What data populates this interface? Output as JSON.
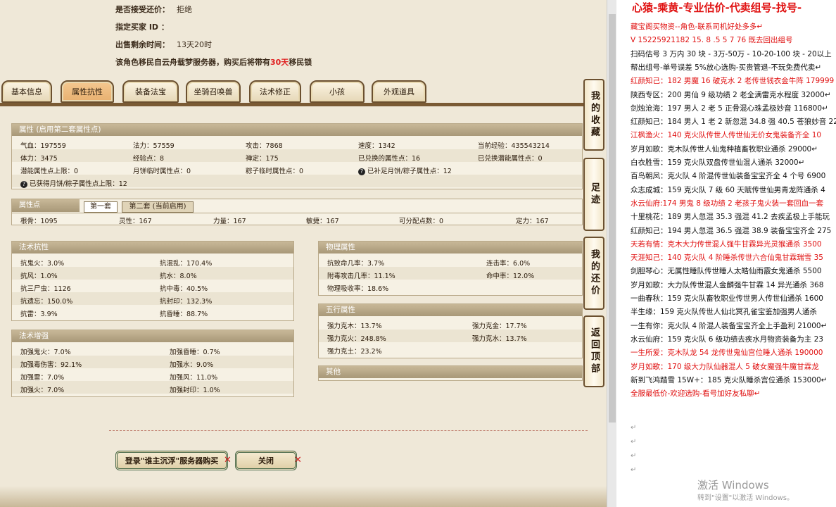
{
  "info": {
    "accept_counter_label": "是否接受还价：",
    "accept_counter_value": "拒绝",
    "buyer_id_label": "指定买家 ID ：",
    "time_left_label": "出售剩余时间：",
    "time_left_value": "13天20时",
    "migrate_prefix": "该角色移民自云舟载梦服务器，购买后将带有",
    "migrate_days": "30天",
    "migrate_suffix": "移民锁"
  },
  "tabs": [
    "基本信息",
    "属性抗性",
    "装备法宝",
    "坐骑召唤兽",
    "法术修正",
    "小孩",
    "外观道具"
  ],
  "attr": {
    "header": "属性 (启用第二套属性点)",
    "row1": [
      "气血：197559",
      "法力：57559",
      "攻击：7868",
      "速度：1342",
      "当前经验：435543214"
    ],
    "row2": [
      "体力：3475",
      "经验点：8",
      "禅定：175",
      "已兑换的属性点：16",
      "已兑换潜能属性点：0"
    ],
    "row3": [
      "潜能属性点上限：0",
      "月饼临时属性点：0",
      "粽子临时属性点：0",
      "已补足月饼/粽子属性点：12"
    ],
    "row4": "已获得月饼/粽子属性点上限：12"
  },
  "points": {
    "header": "属性点",
    "tab1": "第一套",
    "tab2": "第二套 (当前启用)",
    "row": [
      "根骨：1095",
      "灵性：167",
      "力量：167",
      "敏捷：167",
      "可分配点数：0",
      "定力：167"
    ]
  },
  "resist": {
    "header": "法术抗性",
    "left": [
      "抗鬼火：3.0%",
      "抗风：1.0%",
      "抗三尸虫：1126",
      "抗遗忘：150.0%",
      "抗雷：3.9%"
    ],
    "right": [
      "抗混乱：170.4%",
      "抗水：8.0%",
      "抗中毒：40.5%",
      "抗封印：132.3%",
      "抗昏睡：88.7%"
    ]
  },
  "enhance": {
    "header": "法术增强",
    "left": [
      "加强鬼火：7.0%",
      "加强毒伤害：92.1%",
      "加强雷：7.0%",
      "加强火：7.0%"
    ],
    "right": [
      "加强昏睡：0.7%",
      "加强水：9.0%",
      "加强风：11.0%",
      "加强封印：1.0%"
    ]
  },
  "physical": {
    "header": "物理属性",
    "left": [
      "抗致命几率：3.7%",
      "附毒攻击几率：11.1%",
      "物理吸收率：18.6%"
    ],
    "right": [
      "连击率：6.0%",
      "命中率：12.0%"
    ]
  },
  "elements": {
    "header": "五行属性",
    "left": [
      "强力克木：13.7%",
      "强力克火：248.8%",
      "强力克土：23.2%"
    ],
    "right": [
      "强力克金：17.7%",
      "强力克水：13.7%"
    ]
  },
  "other": {
    "header": "其他"
  },
  "side_buttons": [
    "我的收藏",
    "足迹",
    "我的还价",
    "返回顶部"
  ],
  "buttons": {
    "login_buy": "登录\"谁主沉浮\"服务器购买",
    "close": "关闭"
  },
  "doc": {
    "title": "心猿-乘黄-专业估价-代卖组号-找号-",
    "lines": [
      {
        "t": "藏宝阁买物资--角色-联系司机好处多多↵",
        "red": true
      },
      {
        "t": "V 15225921182    15. 8 .5 5 7 76  既去回出组号",
        "red": true
      },
      {
        "t": "扫码估号 3 万内 30 块 - 3万-50万 - 10-20-100 块 - 20以上",
        "red": false
      },
      {
        "t": "帮出组号-单号误差 5%放心选购-买贵管退-不玩免费代卖↵",
        "red": false
      },
      {
        "t": "红颜知己：182 男魔 16 破克水 2 老传世钱衣金牛阵 179999",
        "red": true
      },
      {
        "t": "陕西专区：200 男仙 9 级功绩 2 老全满雷克水程度 32000↵",
        "red": false
      },
      {
        "t": "剑烛沧海：197 男人 2 老 5 正骨混心珠孟极妙音 116800↵",
        "red": false
      },
      {
        "t": "红颜知己：184 男人 1 老 2 新忽混 34.8 强 40.5 苍狼妙音 22",
        "red": false
      },
      {
        "t": "江枫渔火：140 克火队传世人传世仙无价女鬼装备齐全 10",
        "red": true
      },
      {
        "t": "岁月如歌：克木队传世人仙鬼种植畜牧职业通杀 29000↵",
        "red": false
      },
      {
        "t": "白衣胜雪：159 克火队双盘传世仙混人通杀 32000↵",
        "red": false
      },
      {
        "t": "百鸟朝凤：克火队 4 阶混传世仙装备宝宝齐全 4 个号 6900",
        "red": false
      },
      {
        "t": "众志成城：159 克火队 7 级 60 天赋传世仙男青龙阵通杀 4",
        "red": false
      },
      {
        "t": "水云仙府:174 男鬼 8 级功绩 2 老孩子鬼火装一套回血一套",
        "red": true
      },
      {
        "t": "十里桃花：189 男人忽混 35.3 强混 41.2 去疾孟极上手能玩",
        "red": false
      },
      {
        "t": "红颜知己：194 男人忽混 36.5 强混 38.9 装备宝宝齐全 275",
        "red": false
      },
      {
        "t": "天若有情：克木大力传世混人强牛甘霖异光灵猴通杀 3500",
        "red": true
      },
      {
        "t": "天涯知己：140 克火队 4 阶睡杀传世六合仙鬼甘霖瑞雪 35",
        "red": true
      },
      {
        "t": "剑胆琴心：无属性睡队传世睡人太皓仙雨霰女鬼通杀 5500",
        "red": false
      },
      {
        "t": "岁月如歌：大力队传世混人金麟强牛甘霖 14 异光通杀 368",
        "red": false
      },
      {
        "t": "一曲春秋：159 克火队畜牧职业传世男人传世仙通杀 1600",
        "red": false
      },
      {
        "t": "半生缘：159 克火队传世人仙北冥孔雀宝鉴加强男人通杀",
        "red": false
      },
      {
        "t": "一生有你：克火队 4 阶混人装备宝宝齐全上手盈利 21000↵",
        "red": false
      },
      {
        "t": "水云仙府：159 克火队 6 级功绩去疾水月物资装备为主 23",
        "red": false
      },
      {
        "t": "一生所爱：克木队龙 54 龙传世鬼仙宫位睡人通杀 190000",
        "red": true
      },
      {
        "t": "岁月如歌：170 级大力队仙器混人 5 破女魔强牛魔甘霖龙",
        "red": true
      },
      {
        "t": "新到飞鸿踏雪 15W+：185 克火队睡杀宫位通杀 153000↵",
        "red": false
      },
      {
        "t": "全服最低价-欢迎选购-看号加好友私聊↵",
        "red": true
      }
    ],
    "watermark": "激活 Windows",
    "watermark_sub": "转到\"设置\"以激活 Windows。"
  }
}
